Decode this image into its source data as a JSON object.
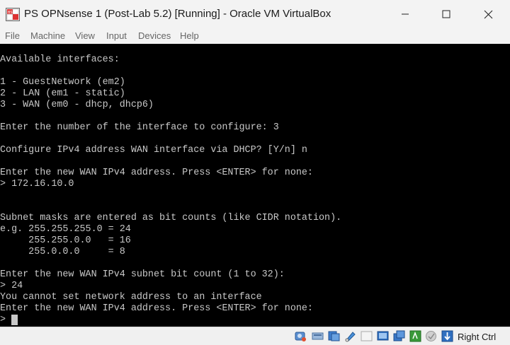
{
  "window": {
    "title": "PS OPNsense 1 (Post-Lab 5.2) [Running] - Oracle VM VirtualBox"
  },
  "menu": [
    "File",
    "Machine",
    "View",
    "Input",
    "Devices",
    "Help"
  ],
  "console": {
    "lines": [
      "Available interfaces:",
      "",
      "1 - GuestNetwork (em2)",
      "2 - LAN (em1 - static)",
      "3 - WAN (em0 - dhcp, dhcp6)",
      "",
      "Enter the number of the interface to configure: 3",
      "",
      "Configure IPv4 address WAN interface via DHCP? [Y/n] n",
      "",
      "Enter the new WAN IPv4 address. Press <ENTER> for none:",
      "> 172.16.10.0",
      "",
      "",
      "Subnet masks are entered as bit counts (like CIDR notation).",
      "e.g. 255.255.255.0 = 24",
      "     255.255.0.0   = 16",
      "     255.0.0.0     = 8",
      "",
      "Enter the new WAN IPv4 subnet bit count (1 to 32):",
      "> 24",
      "You cannot set network address to an interface",
      "Enter the new WAN IPv4 address. Press <ENTER> for none:",
      "> "
    ]
  },
  "statusbar": {
    "icons": [
      "hard-disk-icon",
      "optical-drive-icon",
      "audio-icon",
      "network-icon",
      "usb-icon",
      "shared-folders-icon",
      "display-icon",
      "recording-icon",
      "cpu-activity-icon",
      "mouse-integration-icon",
      "keyboard-capture-icon"
    ],
    "host_key": "Right Ctrl"
  }
}
